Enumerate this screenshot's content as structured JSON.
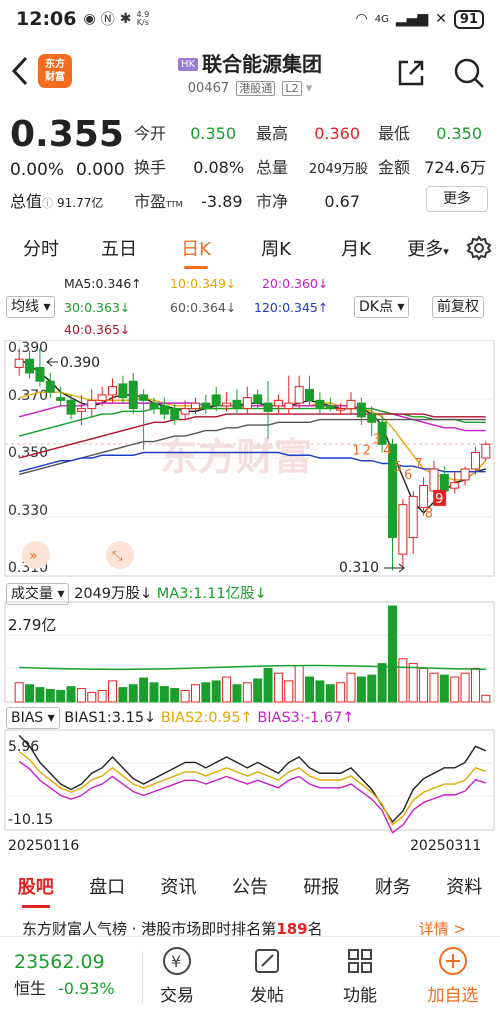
{
  "status_bar": {
    "time": "12:06",
    "net_speed_value": "4.9",
    "net_speed_unit": "K/s",
    "signal": "4G",
    "battery": "91"
  },
  "header": {
    "logo_line1": "东方",
    "logo_line2": "财富",
    "market_badge": "HK",
    "stock_name": "联合能源集团",
    "stock_code": "00467",
    "connect_tag": "港股通",
    "level_tag": "L2"
  },
  "quote": {
    "price": "0.355",
    "change_pct": "0.00%",
    "change_abs": "0.000",
    "open_label": "今开",
    "open_value": "0.350",
    "high_label": "最高",
    "high_value": "0.360",
    "low_label": "最低",
    "low_value": "0.350",
    "turnover_label": "换手",
    "turnover_value": "0.08%",
    "volume_label": "总量",
    "volume_value": "2049万股",
    "amount_label": "金额",
    "amount_value": "724.6万",
    "mcap_label": "总值",
    "mcap_value": "91.77亿",
    "pe_label": "市盈",
    "pe_sup": "TTM",
    "pe_value": "-3.89",
    "pb_label": "市净",
    "pb_value": "0.67",
    "more_label": "更多"
  },
  "period_tabs": [
    "分时",
    "五日",
    "日K",
    "周K",
    "月K",
    "更多"
  ],
  "period_active": 2,
  "indicators": {
    "main_selector": "均线",
    "ma5": "MA5:0.346↑",
    "ma10": "10:0.349↓",
    "ma20": "20:0.360↓",
    "ma30": "30:0.363↓",
    "ma60": "60:0.364↓",
    "ma120": "120:0.345↑",
    "ma40": "40:0.365↓",
    "dk_selector": "DK点",
    "adjust_selector": "前复权"
  },
  "kline": {
    "y_ticks": [
      "0.390",
      "0.370",
      "0.350",
      "0.330",
      "0.310"
    ],
    "max_marker": "0.390",
    "min_marker": "0.310",
    "watermark": "东方财富",
    "signals": [
      "1",
      "2",
      "3",
      "4",
      "5",
      "6",
      "7",
      "8",
      "9"
    ]
  },
  "volume": {
    "label": "成交量",
    "vol_value": "2049万股↓",
    "ma3": "MA3:1.11亿股↓",
    "max_tick": "2.79亿"
  },
  "bias": {
    "label": "BIAS",
    "bias1": "BIAS1:3.15↓",
    "bias2": "BIAS2:0.95↑",
    "bias3": "BIAS3:-1.67↑",
    "y_top": "5.96",
    "y_bottom": "-10.15",
    "date_start": "20250116",
    "date_end": "20250311"
  },
  "content_tabs": [
    "股吧",
    "盘口",
    "资讯",
    "公告",
    "研报",
    "财务",
    "资料"
  ],
  "content_active": 0,
  "ticker": {
    "text": "东方财富人气榜 · 港股市场即时排名第",
    "rank": "189",
    "suffix": "名",
    "link": "详情 >"
  },
  "bottom_bar": {
    "index_value": "23562.09",
    "index_name": "恒生",
    "index_change": "-0.93%",
    "items": [
      "交易",
      "发帖",
      "功能",
      "加自选"
    ]
  },
  "colors": {
    "up": "#e52222",
    "down": "#1a9e2c",
    "accent": "#f26c21"
  }
}
